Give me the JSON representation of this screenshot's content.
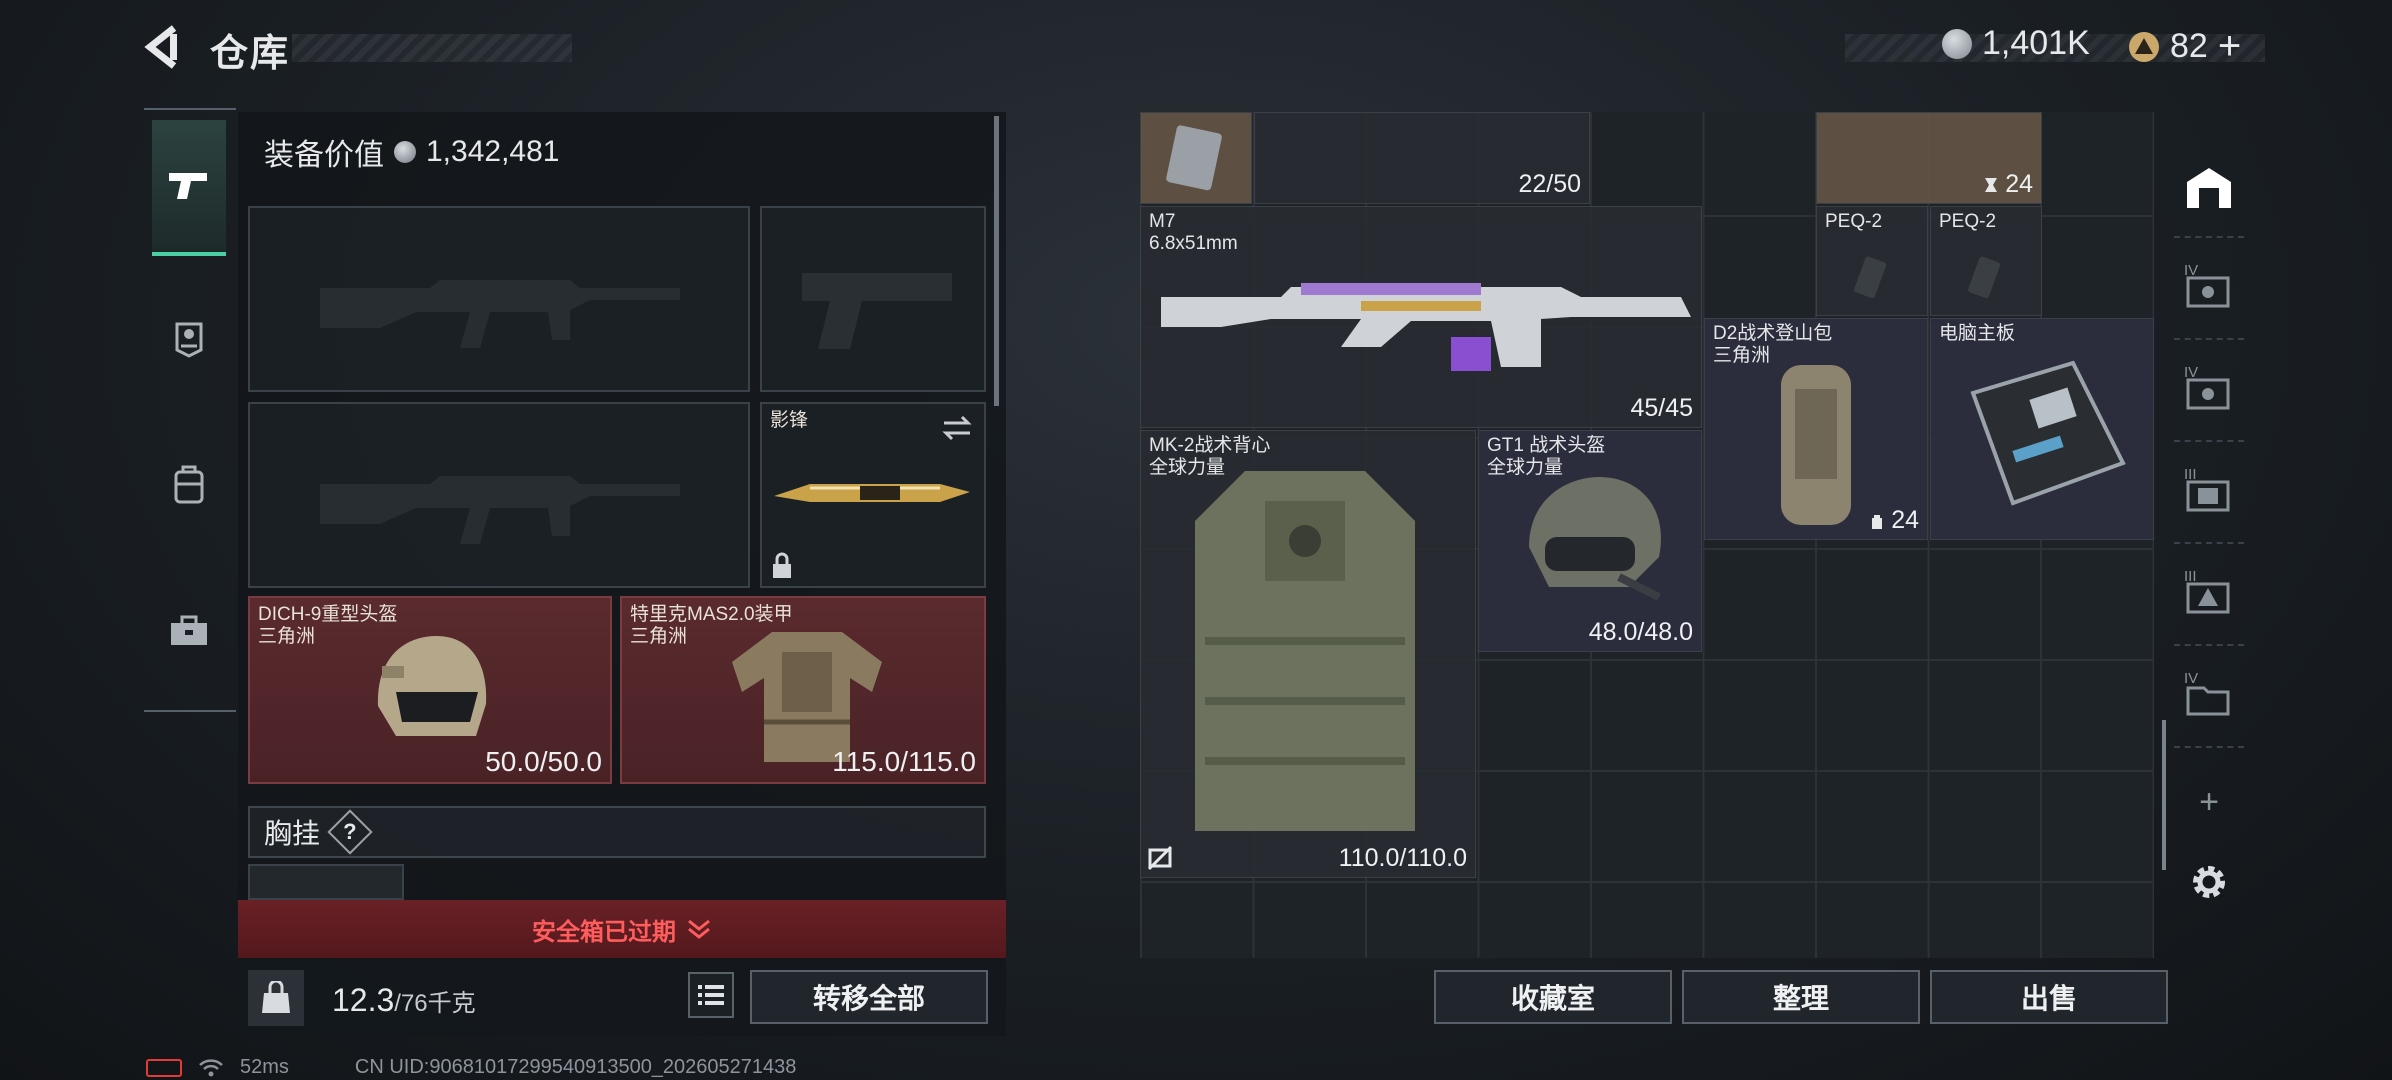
{
  "header": {
    "title": "仓库",
    "currency_coins": "1,401K",
    "currency_tokens": "82",
    "add_symbol": "+"
  },
  "left_nav": {
    "items": [
      "weapon-icon",
      "badge-icon",
      "backpack-icon",
      "toolbox-icon"
    ],
    "active": 0
  },
  "equipment": {
    "value_label": "装备价值",
    "value": "1,342,481",
    "slots": {
      "primary1": {
        "label": ""
      },
      "sidearm": {
        "label": ""
      },
      "primary2": {
        "label": ""
      },
      "melee": {
        "label": "影锋"
      },
      "helmet": {
        "name": "DICH-9重型头盔",
        "faction": "三角洲",
        "durability": "50.0/50.0"
      },
      "armor": {
        "name": "特里克MAS2.0装甲",
        "faction": "三角洲",
        "durability": "115.0/115.0"
      }
    },
    "chest_rig_label": "胸挂",
    "chest_rig_help": "?",
    "safebox_status": "安全箱已过期",
    "weight_current": "12.3",
    "weight_max": "/76千克",
    "transfer_all": "转移全部"
  },
  "stash": {
    "items": {
      "ammo_count": "22/50",
      "top_right_count": "24",
      "m7": {
        "name": "M7",
        "caliber": "6.8x51mm",
        "count": "45/45"
      },
      "peq_a": {
        "name": "PEQ-2"
      },
      "peq_b": {
        "name": "PEQ-2"
      },
      "backpack": {
        "name": "D2战术登山包",
        "faction": "三角洲",
        "count": "24"
      },
      "motherboard": {
        "name": "电脑主板"
      },
      "vest": {
        "name": "MK-2战术背心",
        "faction": "全球力量",
        "durability": "110.0/110.0"
      },
      "gt1": {
        "name": "GT1 战术头盔",
        "faction": "全球力量",
        "durability": "48.0/48.0"
      }
    },
    "buttons": {
      "collection": "收藏室",
      "sort": "整理",
      "sell": "出售"
    }
  },
  "right_nav": {
    "levels": [
      "IV",
      "IV",
      "III",
      "III",
      "IV"
    ],
    "add": "+"
  },
  "status_bar": {
    "ping": "52ms",
    "uid": "CN UID:906810172995409135​00_202605271438"
  },
  "colors": {
    "accent_green": "#4bd0a6",
    "warning_red": "#ff5d5d",
    "equip_red_bg": "#5a2a2e"
  }
}
